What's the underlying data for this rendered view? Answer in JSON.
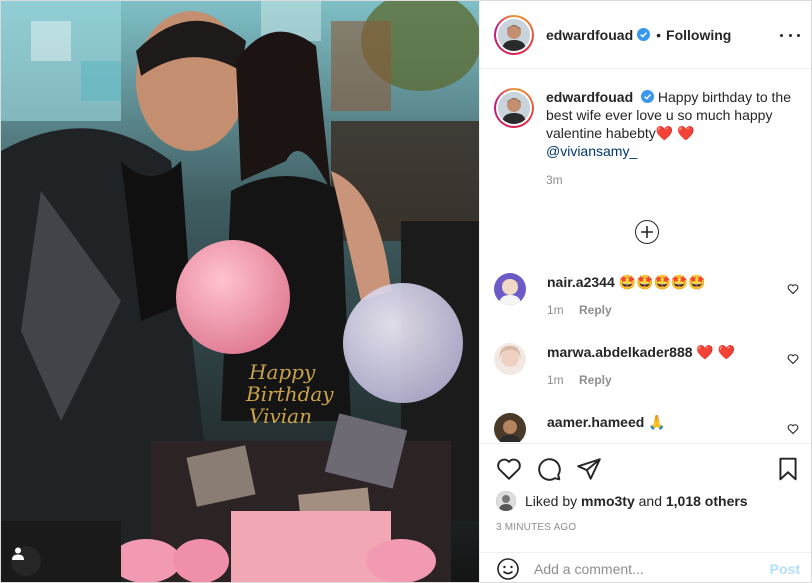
{
  "post": {
    "author": "edwardfouad",
    "following_label": "Following",
    "separator": "•",
    "photo": {
      "cake_topper_text": "Happy Birthday Vivian",
      "description_icon": "photo-image"
    }
  },
  "caption": {
    "author": "edwardfouad",
    "text": "Happy birthday to the best wife ever love u so much happy valentine habebty",
    "hearts": "❤️ ❤️",
    "mention": "@viviansamy_",
    "time": "3m"
  },
  "comments": [
    {
      "user": "nair.a2344",
      "text": "🤩🤩🤩🤩🤩",
      "time": "1m",
      "reply": "Reply"
    },
    {
      "user": "marwa.abdelkader888",
      "text": "❤️ ❤️",
      "time": "1m",
      "reply": "Reply"
    },
    {
      "user": "aamer.hameed",
      "text": "🙏"
    }
  ],
  "likes": {
    "prefix": "Liked by",
    "user": "mmo3ty",
    "and": "and",
    "count": "1,018 others"
  },
  "timestamp": "3 MINUTES AGO",
  "composer": {
    "placeholder": "Add a comment...",
    "post_label": "Post"
  },
  "colors": {
    "verified": "#3897f0",
    "mention": "#00376b",
    "post_disabled": "#b2dffc",
    "muted": "#8e8e8e"
  }
}
